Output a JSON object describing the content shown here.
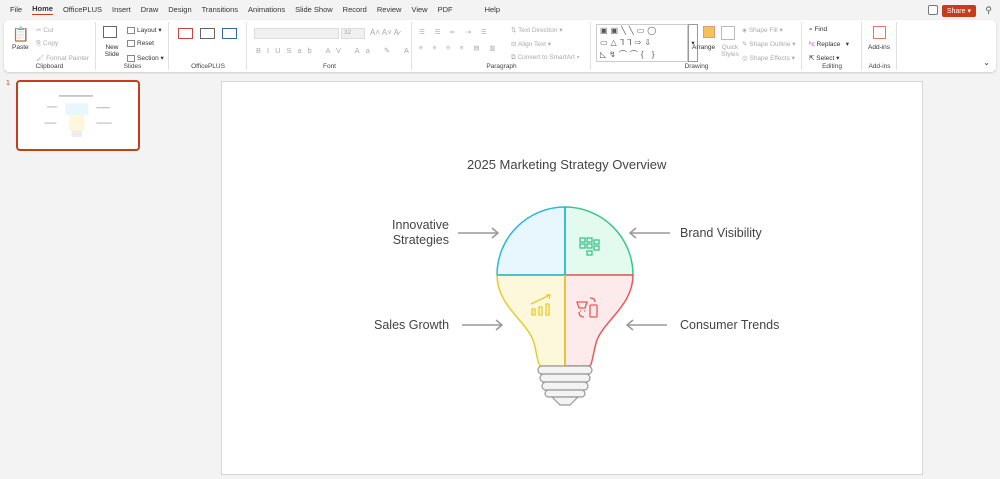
{
  "menu": [
    "File",
    "Home",
    "OfficePLUS",
    "Insert",
    "Draw",
    "Design",
    "Transitions",
    "Animations",
    "Slide Show",
    "Record",
    "Review",
    "View",
    "PDF",
    "Help"
  ],
  "share_label": "Share",
  "clipboard": {
    "paste": "Paste",
    "cut": "Cut",
    "copy": "Copy",
    "format_painter": "Format Painter",
    "label": "Clipboard"
  },
  "slides": {
    "new_slide": "New Slide",
    "layout": "Layout",
    "reset": "Reset",
    "section": "Section",
    "label": "Slides"
  },
  "officeplus": {
    "label": "OfficePLUS"
  },
  "font": {
    "size": "32",
    "label": "Font"
  },
  "paragraph": {
    "text_direction": "Text Direction",
    "align_text": "Align Text",
    "convert": "Convert to SmartArt",
    "label": "Paragraph"
  },
  "drawing": {
    "arrange": "Arrange",
    "quick_styles": "Quick Styles",
    "shape_fill": "Shape Fill",
    "shape_outline": "Shape Outline",
    "shape_effects": "Shape Effects",
    "label": "Drawing"
  },
  "editing": {
    "find": "Find",
    "replace": "Replace",
    "select": "Select",
    "label": "Editing"
  },
  "addins": {
    "btn": "Add-ins",
    "label": "Add-ins"
  },
  "thumbnail": {
    "number": "1"
  },
  "slide": {
    "title": "2025 Marketing Strategy Overview",
    "innovative": "Innovative Strategies",
    "brand": "Brand Visibility",
    "sales": "Sales Growth",
    "consumer": "Consumer Trends"
  },
  "colors": {
    "blue": "#29b6e0",
    "green": "#3cc48a",
    "yellow": "#e6cc2a",
    "red": "#e85a5a",
    "accent": "#c43e1c"
  }
}
